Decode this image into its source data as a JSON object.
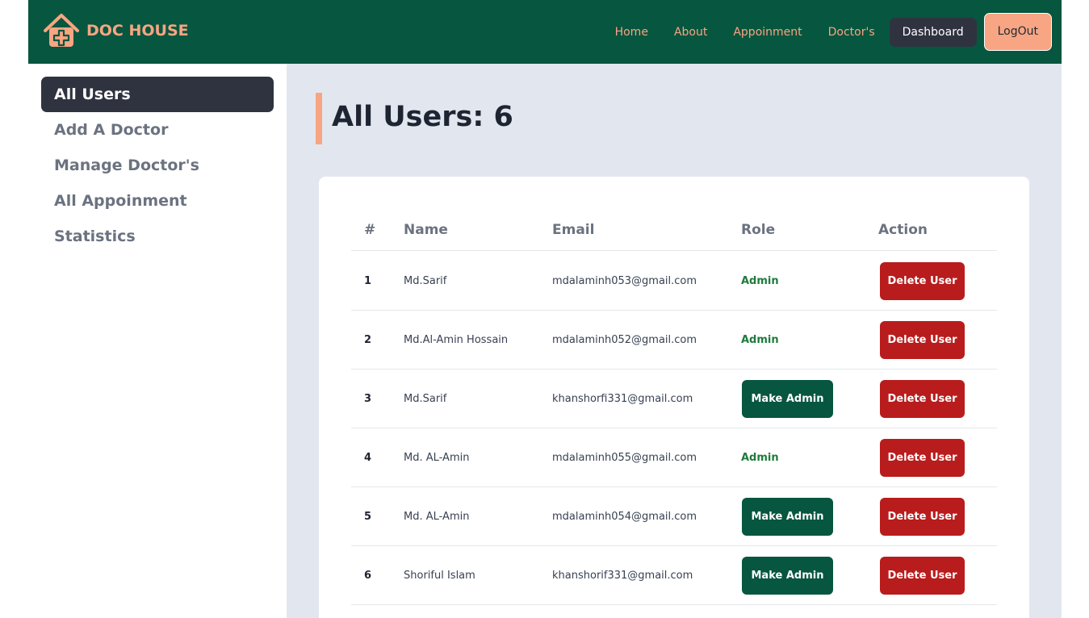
{
  "brand": {
    "name": "DOC HOUSE",
    "icon": "house-medical-icon",
    "accent": "#f7a582",
    "primary": "#07563f"
  },
  "nav": {
    "links": [
      "Home",
      "About",
      "Appoinment",
      "Doctor's"
    ],
    "dashboard": "Dashboard",
    "logout": "LogOut"
  },
  "sidebar": {
    "items": [
      "All Users",
      "Add A Doctor",
      "Manage Doctor's",
      "All Appoinment",
      "Statistics"
    ],
    "active": "All Users"
  },
  "main": {
    "title": "All Users: 6"
  },
  "table": {
    "headers": [
      "#",
      "Name",
      "Email",
      "Role",
      "Action"
    ],
    "rows": [
      {
        "num": "1",
        "name": "Md.Sarif",
        "email": "mdalaminh053@gmail.com",
        "role": "Admin",
        "is_admin": true,
        "action": "Delete User"
      },
      {
        "num": "2",
        "name": "Md.Al-Amin Hossain",
        "email": "mdalaminh052@gmail.com",
        "role": "Admin",
        "is_admin": true,
        "action": "Delete User"
      },
      {
        "num": "3",
        "name": "Md.Sarif",
        "email": "khanshorfi331@gmail.com",
        "role": "Make Admin",
        "is_admin": false,
        "action": "Delete User"
      },
      {
        "num": "4",
        "name": "Md. AL-Amin",
        "email": "mdalaminh055@gmail.com",
        "role": "Admin",
        "is_admin": true,
        "action": "Delete User"
      },
      {
        "num": "5",
        "name": "Md. AL-Amin",
        "email": "mdalaminh054@gmail.com",
        "role": "Make Admin",
        "is_admin": false,
        "action": "Delete User"
      },
      {
        "num": "6",
        "name": "Shoriful Islam",
        "email": "khanshorif331@gmail.com",
        "role": "Make Admin",
        "is_admin": false,
        "action": "Delete User"
      }
    ]
  }
}
